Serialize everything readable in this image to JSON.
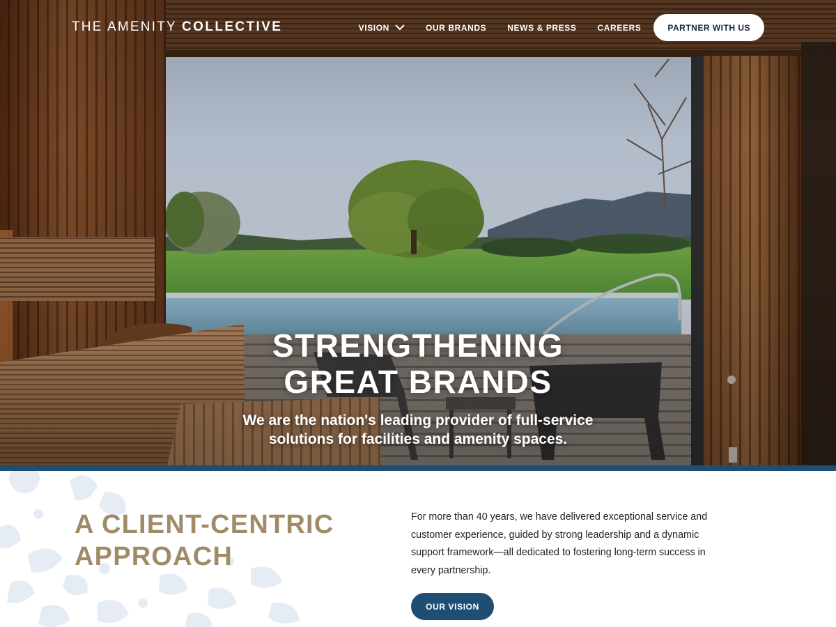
{
  "colors": {
    "brand_blue": "#1f4e75",
    "accent_gold": "#a08b67",
    "nav_text": "#ffffff",
    "button_white": "#ffffff",
    "body_text": "#222222"
  },
  "header": {
    "logo_light": "THE AMENITY",
    "logo_bold": "COLLECTIVE",
    "nav": [
      {
        "label": "VISION",
        "icon": "chevron-down-icon"
      },
      {
        "label": "OUR BRANDS"
      },
      {
        "label": "NEWS & PRESS"
      },
      {
        "label": "CAREERS"
      }
    ],
    "cta_label": "PARTNER WITH US"
  },
  "hero": {
    "title_lines": [
      "STRENGTHENING",
      "GREAT BRANDS"
    ],
    "subtitle_lines": [
      "We are the nation's leading provider of full-service",
      "solutions for facilities and amenity spaces."
    ]
  },
  "intro": {
    "title_lines": [
      "A CLIENT-CENTRIC",
      "APPROACH"
    ],
    "body_lines": [
      "For more than 40 years, we have delivered exceptional service and",
      "customer experience, guided by strong leadership and a dynamic",
      "support framework—all dedicated to fostering long-term success in",
      "every partnership."
    ],
    "button_label": "OUR VISION"
  }
}
